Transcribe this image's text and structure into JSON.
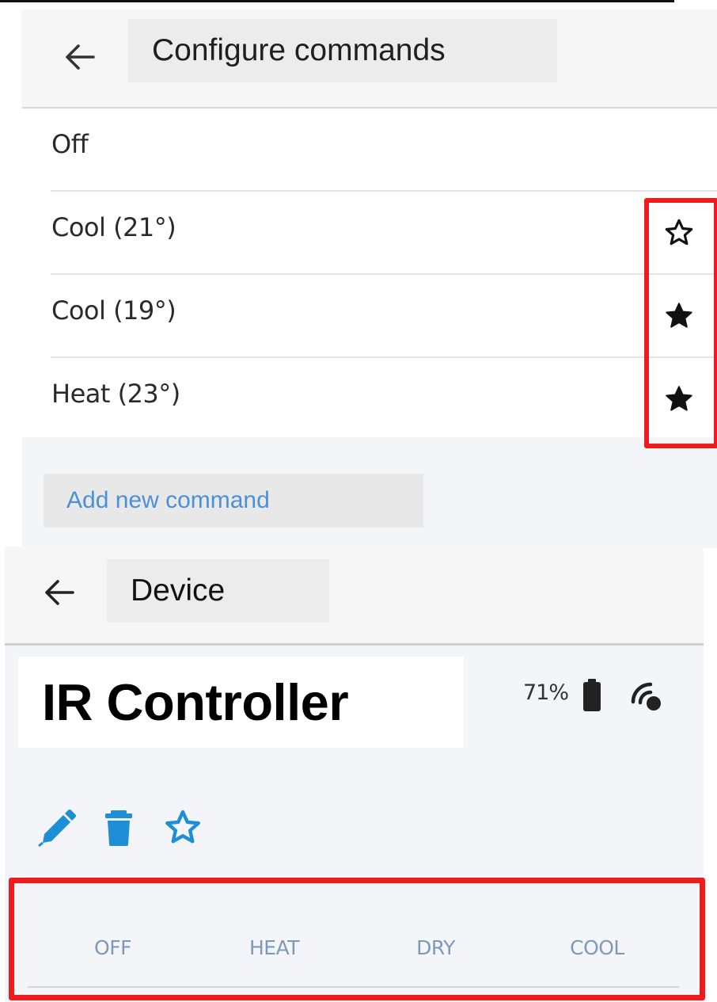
{
  "configure_screen": {
    "title": "Configure commands",
    "commands": [
      {
        "label": "Off",
        "favorite": null
      },
      {
        "label": "Cool (21°)",
        "favorite": false
      },
      {
        "label": "Cool (19°)",
        "favorite": true
      },
      {
        "label": "Heat (23°)",
        "favorite": true
      }
    ],
    "add_button_label": "Add new command"
  },
  "device_screen": {
    "title": "Device",
    "device_name": "IR Controller",
    "battery_level": "71%",
    "modes": [
      "OFF",
      "HEAT",
      "DRY",
      "COOL"
    ]
  },
  "icons": {
    "back": "arrow-left-icon",
    "star_empty": "star-outline-icon",
    "star_filled": "star-filled-icon",
    "battery": "battery-icon",
    "signal": "wireless-signal-icon",
    "edit": "pencil-icon",
    "delete": "trash-icon",
    "favorite": "star-outline-icon"
  },
  "colors": {
    "highlight": "#ee1c1c",
    "accent": "#1e8ed6",
    "link": "#4a90d9",
    "mode_text": "#7f9ab8"
  }
}
